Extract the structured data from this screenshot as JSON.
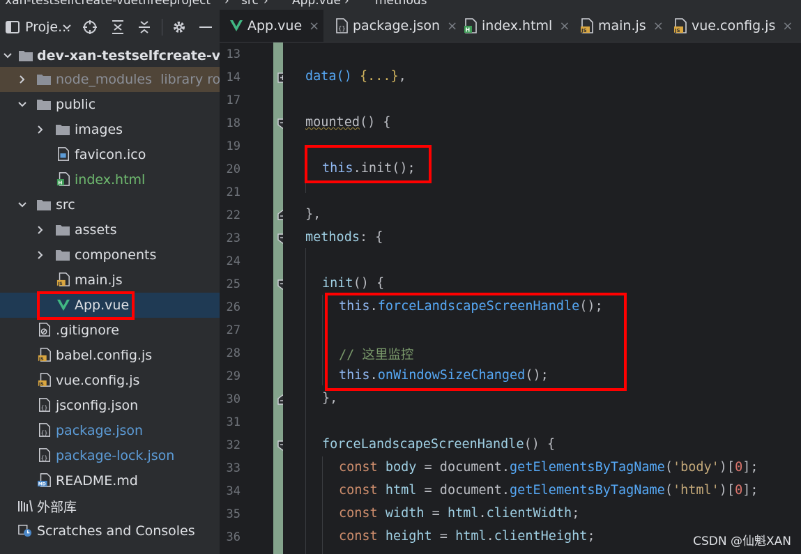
{
  "breadcrumb": {
    "project": "/ xan-testselfcreate-vuethreeproject",
    "sep1": "›",
    "folder": "src",
    "sep2": "›",
    "file": "App.vue",
    "sep3": "›",
    "member": "methods"
  },
  "project_toolbar": {
    "title": "Proje...",
    "icons": [
      "chevron-down-icon",
      "target-icon",
      "expand-all-icon",
      "collapse-all-icon",
      "gear-icon",
      "minimize-icon"
    ]
  },
  "tabs": [
    {
      "label": "App.vue",
      "icon": "vue-icon",
      "close": "×",
      "active": true
    },
    {
      "label": "package.json",
      "icon": "json-icon",
      "close": "×",
      "active": false
    },
    {
      "label": "index.html",
      "icon": "html-icon",
      "close": "×",
      "active": false
    },
    {
      "label": "main.js",
      "icon": "js-icon",
      "close": "×",
      "active": false
    },
    {
      "label": "vue.config.js",
      "icon": "js-icon",
      "close": "×",
      "active": false
    }
  ],
  "tree": {
    "root": "dev-xan-testselfcreate-vuethr",
    "node_modules": "node_modules",
    "node_modules_hint": "library root",
    "public": "public",
    "images": "images",
    "favicon": "favicon.ico",
    "index_html": "index.html",
    "src": "src",
    "assets": "assets",
    "components": "components",
    "main_js": "main.js",
    "app_vue": "App.vue",
    "gitignore": ".gitignore",
    "babel": "babel.config.js",
    "vue_config": "vue.config.js",
    "jsconfig": "jsconfig.json",
    "package_json": "package.json",
    "package_lock": "package-lock.json",
    "readme": "README.md",
    "external_libs": "外部库",
    "scratches": "Scratches and Consoles"
  },
  "editor": {
    "line_numbers": [
      "13",
      "14",
      "17",
      "18",
      "19",
      "20",
      "21",
      "22",
      "23",
      "24",
      "25",
      "26",
      "27",
      "28",
      "29",
      "30",
      "31",
      "32",
      "33",
      "34",
      "35",
      "36"
    ],
    "code": {
      "l14_a": "data() ",
      "l14_b": "{...}",
      "l14_c": ",",
      "l18_a": "mounted",
      "l18_b": "() {",
      "l20_a": "this",
      "l20_b": ".init();",
      "l22": "},",
      "l23_a": "methods",
      "l23_b": ": {",
      "l25_a": "init",
      "l25_b": "() {",
      "l26_a": "this",
      "l26_b": ".",
      "l26_c": "forceLandscapeScreenHandle",
      "l26_d": "();",
      "l28": "// 这里监控",
      "l29_a": "this",
      "l29_b": ".",
      "l29_c": "onWindowSizeChanged",
      "l29_d": "();",
      "l30": "},",
      "l32_a": "forceLandscapeScreenHandle",
      "l32_b": "() {",
      "l33_a": "const ",
      "l33_b": "body",
      "l33_c": " = document.",
      "l33_d": "getElementsByTagName",
      "l33_e": "(",
      "l33_f": "'body'",
      "l33_g": ")[",
      "l33_h": "0",
      "l33_i": "];",
      "l34_a": "const ",
      "l34_b": "html",
      "l34_c": " = document.",
      "l34_d": "getElementsByTagName",
      "l34_e": "(",
      "l34_f": "'html'",
      "l34_g": ")[",
      "l34_h": "0",
      "l34_i": "];",
      "l35_a": "const ",
      "l35_b": "width",
      "l35_c": " = ",
      "l35_d": "html",
      "l35_e": ".",
      "l35_f": "clientWidth",
      "l35_g": ";",
      "l36_a": "const ",
      "l36_b": "height",
      "l36_c": " = ",
      "l36_d": "html",
      "l36_e": ".",
      "l36_f": "clientHeight",
      "l36_g": ";"
    }
  },
  "annotation_color": "#ff0000",
  "watermark": "CSDN @仙魁XAN"
}
